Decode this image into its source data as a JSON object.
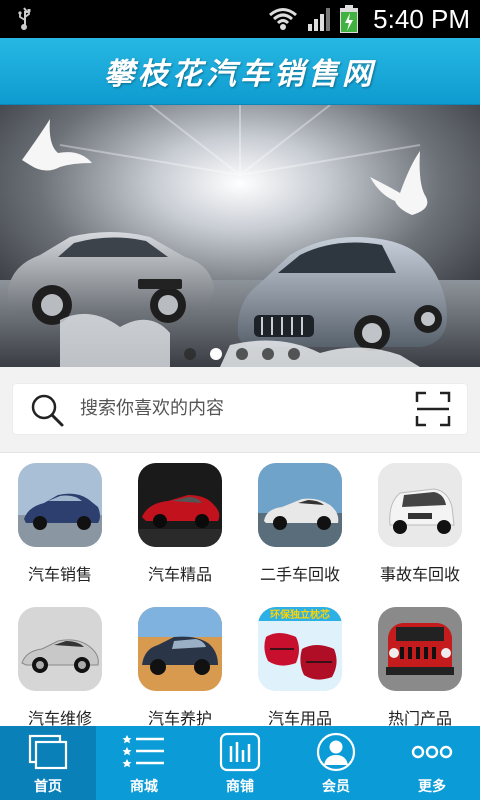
{
  "status_bar": {
    "time": "5:40 PM"
  },
  "header": {
    "title": "攀枝花汽车销售网"
  },
  "banner": {
    "dots": 5,
    "active_dot": 2
  },
  "search": {
    "placeholder": "搜索你喜欢的内容"
  },
  "categories": [
    {
      "label": "汽车销售",
      "car_color": "#2d3f6e",
      "bg": "#a9bfd6"
    },
    {
      "label": "汽车精品",
      "car_color": "#c2121d",
      "bg": "#1a1a1a"
    },
    {
      "label": "二手车回收",
      "car_color": "#e8e8e8",
      "bg": "#6fa3c9"
    },
    {
      "label": "事故车回收",
      "car_color": "#f4f4f4",
      "bg": "#e9e9e9"
    },
    {
      "label": "汽车维修",
      "car_color": "#c8c8c8",
      "bg": "#d6d6d6"
    },
    {
      "label": "汽车养护",
      "car_color": "#2b3548",
      "bg": "#d79a4f"
    },
    {
      "label": "汽车用品",
      "car_color": "#c8102e",
      "bg": "#dff1fb",
      "banner_text": "环保独立枕芯"
    },
    {
      "label": "热门产品",
      "car_color": "#c41c1c",
      "bg": "#8a8a8a"
    }
  ],
  "tabs": [
    {
      "label": "首页",
      "icon": "home-icon",
      "active": true
    },
    {
      "label": "商城",
      "icon": "list-icon",
      "active": false
    },
    {
      "label": "商铺",
      "icon": "shop-icon",
      "active": false
    },
    {
      "label": "会员",
      "icon": "user-icon",
      "active": false
    },
    {
      "label": "更多",
      "icon": "more-icon",
      "active": false
    }
  ],
  "colors": {
    "accent": "#0b9bd6",
    "accent_dark": "#0a80b8",
    "header": "#1aa9dc"
  }
}
